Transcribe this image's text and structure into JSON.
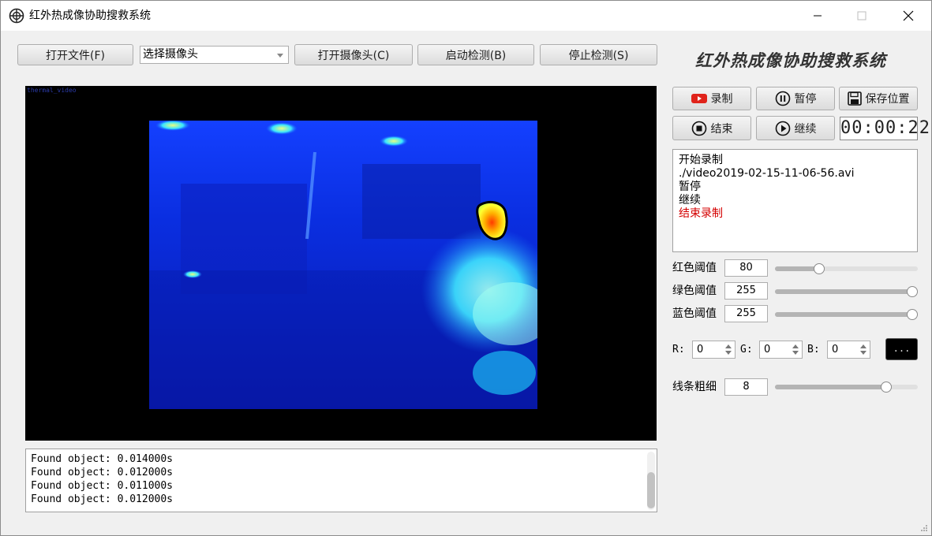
{
  "window": {
    "title": "红外热成像协助搜救系统",
    "minimize": "minimize",
    "maximize": "maximize",
    "close": "close"
  },
  "toolbar": {
    "open_file": "打开文件(F)",
    "camera_select": "选择摄像头",
    "open_camera": "打开摄像头(C)",
    "start_detect": "启动检测(B)",
    "stop_detect": "停止检测(S)"
  },
  "heading": "红外热成像协助搜救系统",
  "video": {
    "corner_text": "thermal_video"
  },
  "log": {
    "lines": [
      "Found object: 0.014000s",
      "Found object: 0.012000s",
      "Found object: 0.011000s",
      "Found object: 0.012000s"
    ]
  },
  "record": {
    "record_btn": "录制",
    "pause_btn": "暂停",
    "save_btn": "保存位置",
    "stop_btn": "结束",
    "resume_btn": "继续",
    "timer": "00:00:22"
  },
  "status_log": {
    "lines": [
      "开始录制",
      "./video2019-02-15-11-06-56.avi",
      "暂停",
      "继续"
    ],
    "last_line": "结束录制"
  },
  "thresholds": {
    "red_label": "红色阈值",
    "red_value": "80",
    "red_fraction": 0.31,
    "green_label": "绿色阈值",
    "green_value": "255",
    "green_fraction": 1.0,
    "blue_label": "蓝色阈值",
    "blue_value": "255",
    "blue_fraction": 1.0
  },
  "color_pick": {
    "r_label": "R:",
    "r_value": "0",
    "g_label": "G:",
    "g_value": "0",
    "b_label": "B:",
    "b_value": "0",
    "swatch_label": "...",
    "swatch_color": "#000000"
  },
  "line_width": {
    "label": "线条粗细",
    "value": "8",
    "fraction": 0.78
  }
}
